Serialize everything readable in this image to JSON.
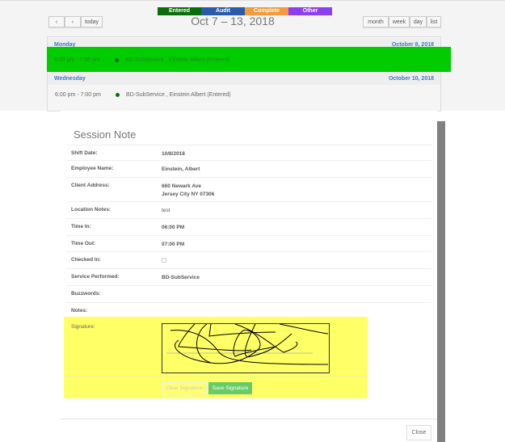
{
  "legend": [
    {
      "label": "Entered",
      "color": "#0a6d0a"
    },
    {
      "label": "Audit",
      "color": "#2a5aa8"
    },
    {
      "label": "Complete",
      "color": "#f29a3c"
    },
    {
      "label": "Other",
      "color": "#8c3ff0"
    }
  ],
  "toolbar": {
    "prev": "‹",
    "next": "›",
    "today": "today",
    "title": "Oct 7 – 13, 2018",
    "views": [
      "month",
      "week",
      "day",
      "list"
    ]
  },
  "days": [
    {
      "day": "Monday",
      "date": "October 8, 2018",
      "time": "6:00 pm - 7:00 pm",
      "event": "BD-SubService , Einstein Albert (Entered)"
    },
    {
      "day": "Wednesday",
      "date": "October 10, 2018",
      "time": "6:00 pm - 7:00 pm",
      "event": "BD-SubService , Einstein Albert (Entered)"
    }
  ],
  "modal": {
    "title": "Session Note",
    "fields": [
      {
        "label": "Shift Date:",
        "value": "10/8/2018"
      },
      {
        "label": "Employee Name:",
        "value": "Einstein, Albert"
      },
      {
        "label": "Client Address:",
        "value": "660 Newark Ave",
        "value2": "Jersey City NY 07306"
      },
      {
        "label": "Location Notes:",
        "value": "test"
      },
      {
        "label": "Time In:",
        "value": "06:00 PM"
      },
      {
        "label": "Time Out:",
        "value": "07:00 PM"
      },
      {
        "label": "Checked In:",
        "value": ""
      },
      {
        "label": "Service Performed:",
        "value": "BD-SubService"
      },
      {
        "label": "Buzzwords:",
        "value": ""
      },
      {
        "label": "Notes:",
        "value": ""
      }
    ],
    "signature_label": "Signature:",
    "clear": "Clear Signature",
    "save": "Save Signature",
    "close": "Close"
  }
}
